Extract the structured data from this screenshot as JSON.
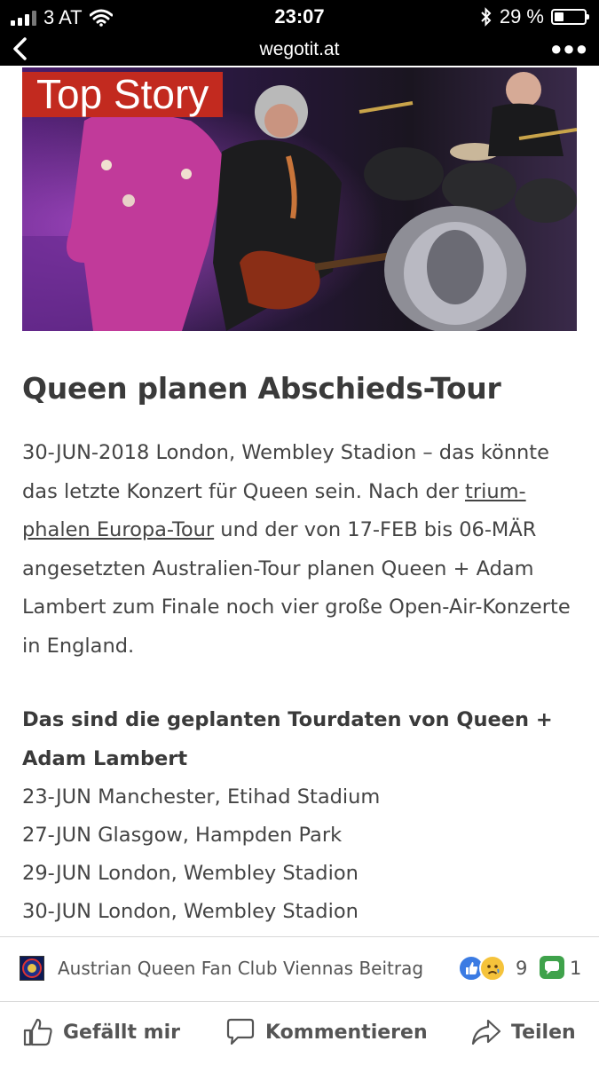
{
  "status_bar": {
    "carrier": "3 AT",
    "time": "23:07",
    "battery": "29 %",
    "battery_level": 0.29
  },
  "browser": {
    "url": "wegotit.at"
  },
  "article": {
    "badge": "Top Story",
    "title": "Queen planen Abschieds-Tour",
    "intro_1": "30-JUN-2018 London, Wembley Stadion – das könnte das letzte Konzert für Queen sein. Nach der ",
    "intro_link": "trium­phalen Europa-Tour",
    "intro_2": " und der von 17-FEB bis 06-MÄR angesetzten Australien-Tour planen Queen + Adam Lambert zum Finale noch vier große Open-Air-Kon­zerte in England.",
    "subhead": "Das sind die geplanten Tourdaten von Queen + Adam Lambert",
    "dates": [
      "23-JUN Manchester, Etihad Stadium",
      "27-JUN Glasgow, Hampden Park",
      "29-JUN London, Wembley Stadion",
      "30-JUN London, Wembley Stadion"
    ]
  },
  "facebook": {
    "page_name": "Austrian Queen Fan Club Viennas Beitrag",
    "reactions_count": "9",
    "comments_count": "1",
    "actions": {
      "like": "Gefällt mir",
      "comment": "Kommentieren",
      "share": "Teilen"
    }
  },
  "icons": {
    "back": "chevron-left-icon",
    "more": "more-dots-icon",
    "wifi": "wifi-icon",
    "bluetooth": "bluetooth-icon",
    "like": "thumbs-up-icon",
    "sad": "sad-face-icon",
    "comment": "comment-icon",
    "share": "share-arrow-icon"
  },
  "colors": {
    "badge": "#c22a1f",
    "fb_blue": "#3b7be3",
    "fb_green": "#3fa24b"
  }
}
